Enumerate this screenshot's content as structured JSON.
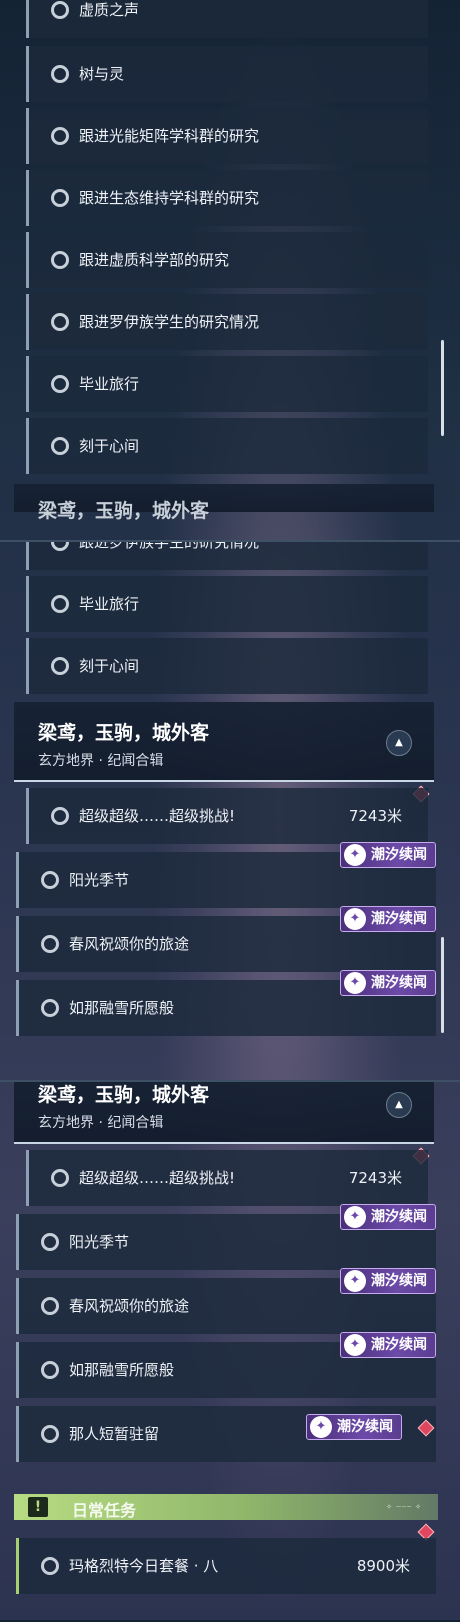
{
  "badge_label": "潮汐续闻",
  "section1": {
    "items": [
      "虚质之声",
      "树与灵",
      "跟进光能矩阵学科群的研究",
      "跟进生态维持学科群的研究",
      "跟进虚质科学部的研究",
      "跟进罗伊族学生的研究情况",
      "毕业旅行",
      "刻于心间"
    ],
    "partial_header": "梁鸢，玉驹，城外客"
  },
  "section2": {
    "items_top": [
      "跟进罗伊族学生的研究情况",
      "毕业旅行",
      "刻于心间"
    ],
    "header": {
      "title": "梁鸢，玉驹，城外客",
      "subtitle": "玄方地界 · 纪闻合辑"
    },
    "challenge": {
      "label": "超级超级……超级挑战!",
      "distance": "7243米"
    },
    "badged_items": [
      "阳光季节",
      "春风祝颂你的旅途",
      "如那融雪所愿般"
    ]
  },
  "section3": {
    "header": {
      "title": "梁鸢，玉驹，城外客",
      "subtitle": "玄方地界 · 纪闻合辑"
    },
    "challenge": {
      "label": "超级超级……超级挑战!",
      "distance": "7243米"
    },
    "badged_items": [
      "阳光季节",
      "春风祝颂你的旅途",
      "如那融雪所愿般",
      "那人短暂驻留"
    ],
    "daily": {
      "label": "日常任务",
      "icon": "!"
    },
    "daily_item": {
      "label": "玛格烈特今日套餐 · 八",
      "distance": "8900米"
    }
  },
  "colors": {
    "badge": "#6c4aa8",
    "marker": "#e0475f",
    "daily": "#b7dc83"
  },
  "icons": {
    "radio": "radio-circle-icon",
    "collapse": "chevron-up-icon",
    "badge": "tidal-star-icon",
    "daily": "exclamation-icon",
    "marker": "red-diamond-marker-icon"
  }
}
